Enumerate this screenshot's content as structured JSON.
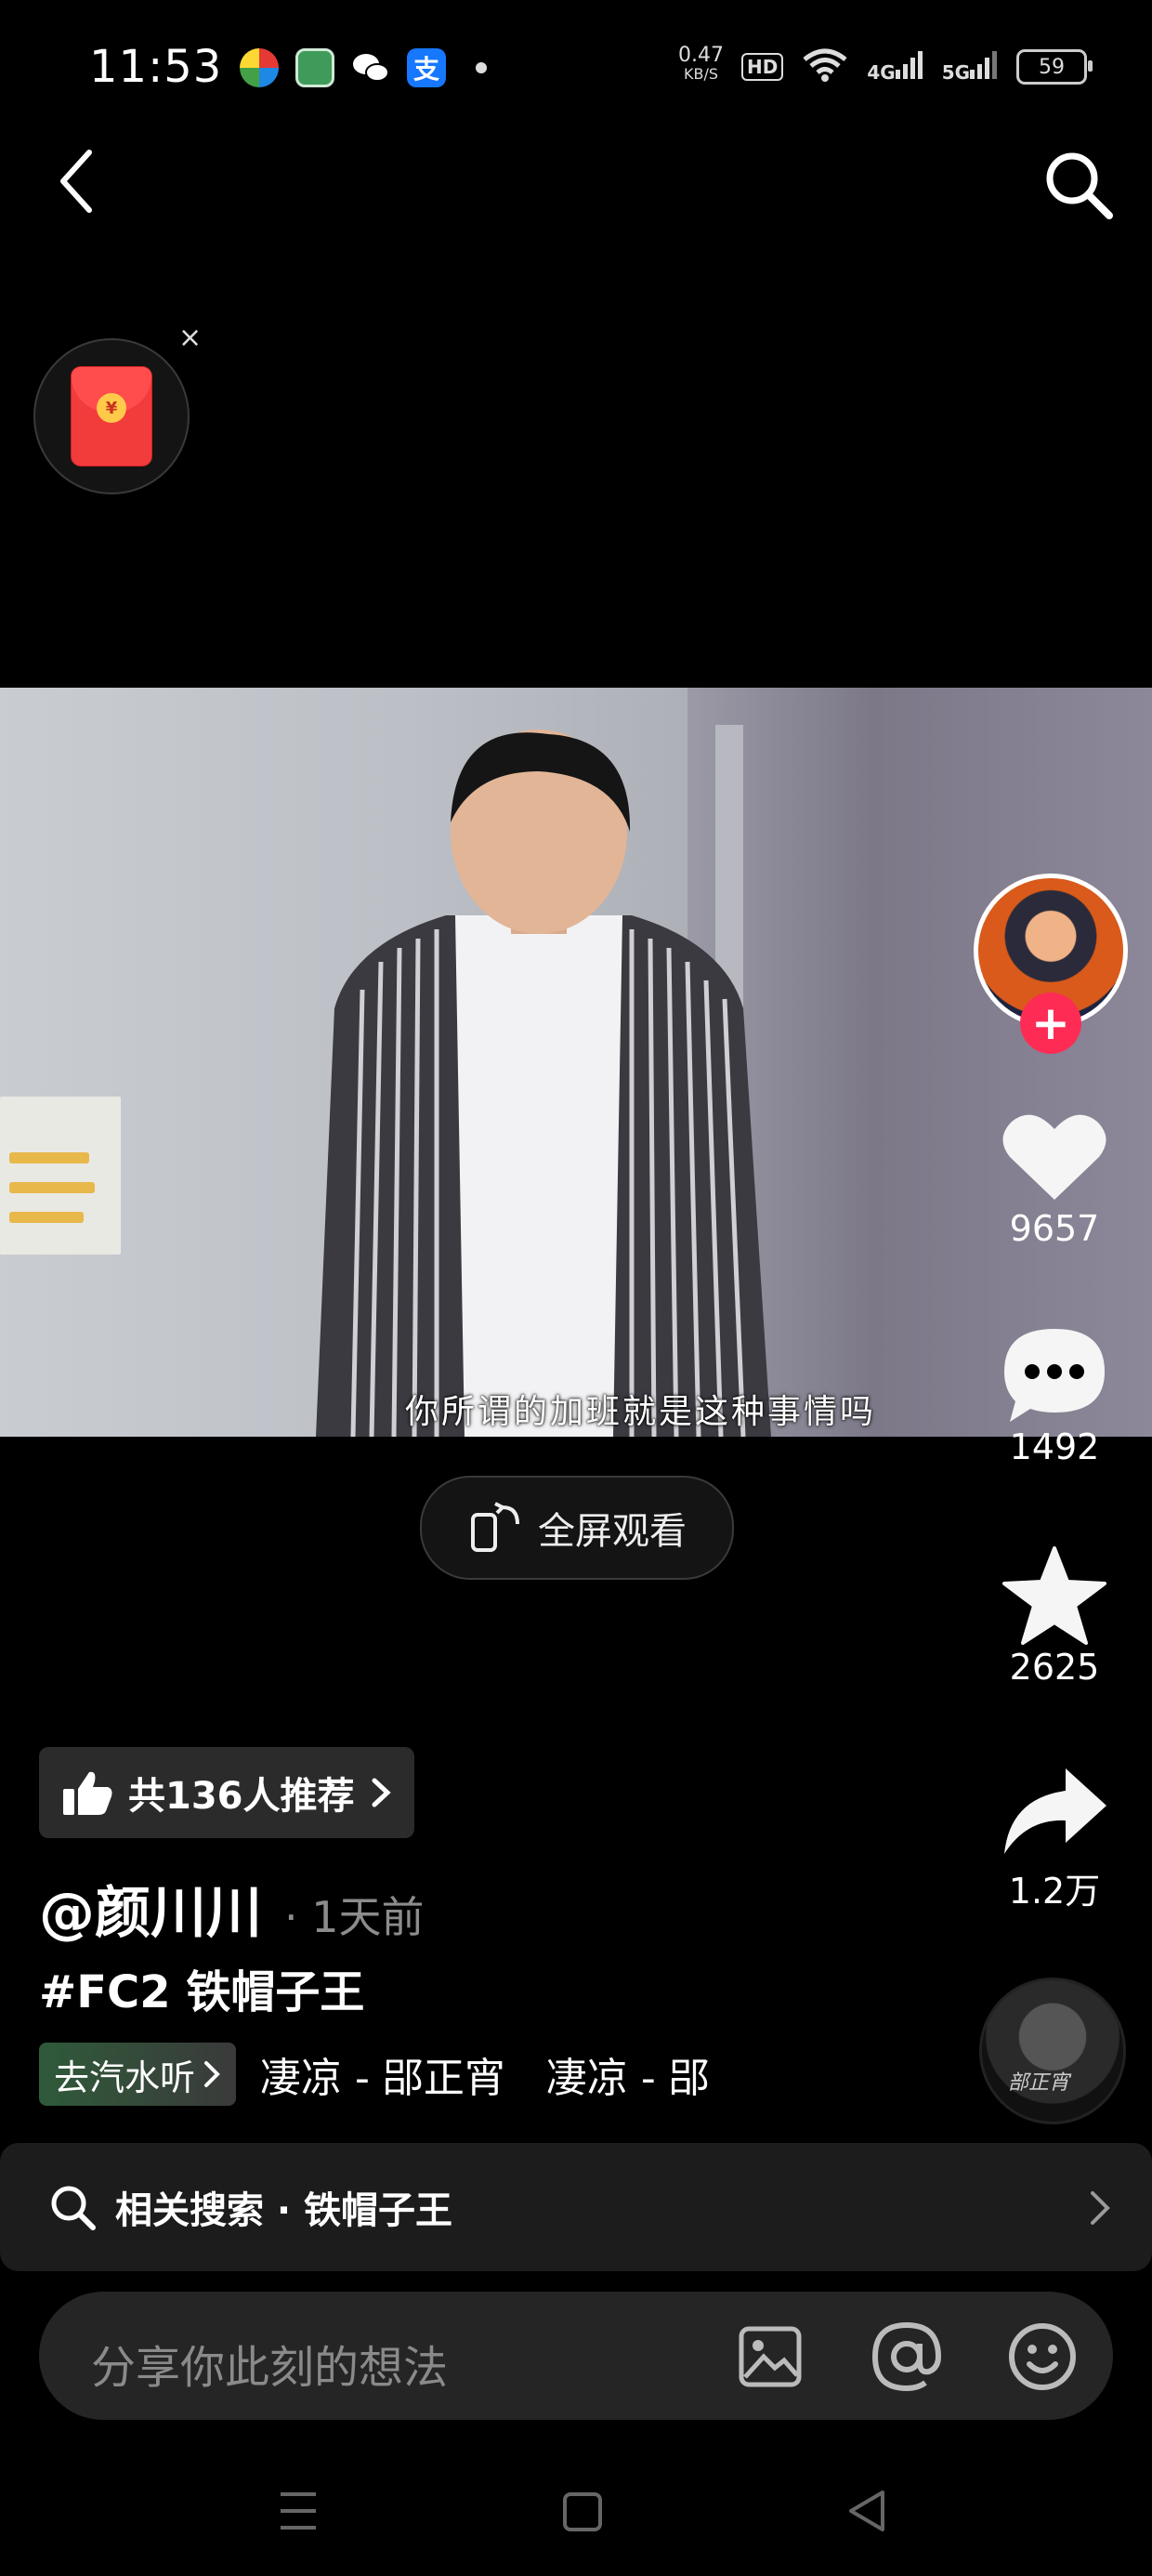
{
  "status_bar": {
    "time": "11:53",
    "net_speed_value": "0.47",
    "net_speed_unit": "KB/S",
    "hd_label": "HD",
    "signal_1": "4G",
    "signal_2": "5G",
    "battery": "59"
  },
  "nav": {
    "back_icon": "chevron-left-icon",
    "search_icon": "search-icon"
  },
  "red_packet": {
    "icon": "red-envelope-icon",
    "coin": "¥",
    "close": "×"
  },
  "video": {
    "subtitle": "你所谓的加班就是这种事情吗",
    "fullscreen_label": "全屏观看"
  },
  "right_rail": {
    "follow_symbol": "+",
    "likes": "9657",
    "comments": "1492",
    "favorites": "2625",
    "shares": "1.2万",
    "disc_text": "部正宵"
  },
  "info": {
    "recommend_label": "共136人推荐",
    "author": "@颜川川",
    "time_ago": "· 1天前",
    "hashtag": "#FC2 铁帽子王",
    "music_tag": "去汽水听",
    "music_title": "凄凉 - 郘正宵　凄凉 - 郘正宵"
  },
  "related_search": {
    "label": "相关搜索 · 铁帽子王"
  },
  "comment_bar": {
    "placeholder": "分享你此刻的想法"
  },
  "colors": {
    "accent_pink": "#fe2c55",
    "background": "#000000"
  }
}
